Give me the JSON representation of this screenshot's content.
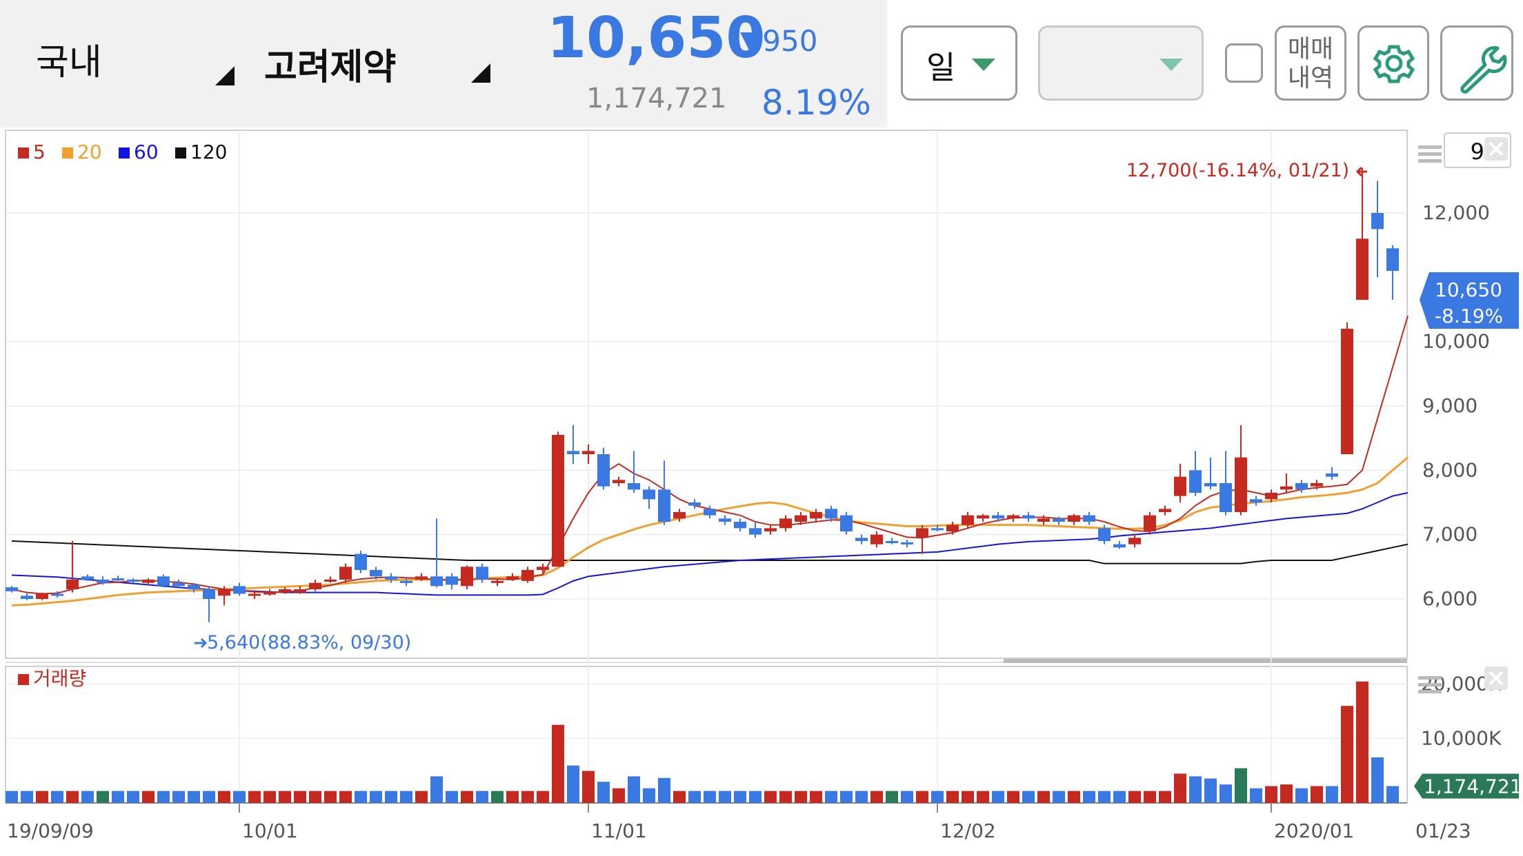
{
  "header": {
    "market": "국내",
    "stock_name": "고려제약",
    "price": "10,650",
    "change": "▼950",
    "volume": "1,174,721",
    "change_rate": "8.19%"
  },
  "toolbar": {
    "period_label": "일",
    "sub_select_value": "",
    "trade_history_label_1": "매매",
    "trade_history_label_2": "내역",
    "settings_icon": "gear-icon",
    "tools_icon": "wrench-icon"
  },
  "colors": {
    "up": "#c42a20",
    "down": "#3a78e2",
    "ma5": "#c42a20",
    "ma20": "#f0a030",
    "ma60": "#1414e0",
    "ma120": "#111111",
    "flat": "#2a7a5a"
  },
  "chart_data": {
    "type": "candlestick",
    "legend": [
      {
        "name": "5",
        "color": "#c42a20"
      },
      {
        "name": "20",
        "color": "#f0a030"
      },
      {
        "name": "60",
        "color": "#1414e0"
      },
      {
        "name": "120",
        "color": "#111111"
      }
    ],
    "period_box_value": "92",
    "y_ticks": [
      6000,
      7000,
      8000,
      9000,
      10000,
      12000
    ],
    "y_tick_labels": [
      "6,000",
      "7,000",
      "8,000",
      "9,000",
      "10,000",
      "12,000"
    ],
    "x_tick_labels": [
      "19/09/09",
      "10/01",
      "11/01",
      "12/02",
      "2020/01",
      "01/23"
    ],
    "x_tick_index": [
      0,
      15,
      38,
      61,
      83,
      92
    ],
    "last_price_label": "10,650",
    "last_change_label": "-8.19%",
    "high_annotation": "12,700(-16.14%, 01/21)",
    "low_annotation": "5,640(88.83%, 09/30)",
    "volume_title": "거래량",
    "volume_ticks": [
      "20,000K",
      "10,000K"
    ],
    "volume_last_label": "1,174,721",
    "candles": [
      [
        6180,
        6120,
        6200,
        6100
      ],
      [
        6050,
        6000,
        6100,
        5980
      ],
      [
        6000,
        6080,
        6100,
        5980
      ],
      [
        6080,
        6050,
        6120,
        6020
      ],
      [
        6150,
        6300,
        6900,
        6100
      ],
      [
        6350,
        6300,
        6380,
        6280
      ],
      [
        6300,
        6250,
        6350,
        6220
      ],
      [
        6320,
        6300,
        6360,
        6280
      ],
      [
        6300,
        6280,
        6320,
        6250
      ],
      [
        6250,
        6300,
        6320,
        6220
      ],
      [
        6350,
        6200,
        6380,
        6180
      ],
      [
        6250,
        6200,
        6300,
        6180
      ],
      [
        6220,
        6150,
        6250,
        6100
      ],
      [
        6150,
        6000,
        6200,
        5640
      ],
      [
        6050,
        6150,
        6200,
        5900
      ],
      [
        6200,
        6080,
        6250,
        6050
      ],
      [
        6050,
        6080,
        6120,
        6000
      ],
      [
        6080,
        6100,
        6150,
        6050
      ],
      [
        6100,
        6150,
        6180,
        6080
      ],
      [
        6100,
        6150,
        6200,
        6080
      ],
      [
        6150,
        6250,
        6300,
        6120
      ],
      [
        6280,
        6300,
        6350,
        6250
      ],
      [
        6300,
        6500,
        6550,
        6250
      ],
      [
        6700,
        6450,
        6750,
        6400
      ],
      [
        6450,
        6350,
        6500,
        6300
      ],
      [
        6350,
        6300,
        6400,
        6250
      ],
      [
        6280,
        6250,
        6320,
        6200
      ],
      [
        6300,
        6350,
        6400,
        6280
      ],
      [
        6350,
        6200,
        7250,
        6180
      ],
      [
        6350,
        6220,
        6400,
        6150
      ],
      [
        6200,
        6500,
        6520,
        6150
      ],
      [
        6500,
        6300,
        6550,
        6250
      ],
      [
        6250,
        6280,
        6300,
        6200
      ],
      [
        6300,
        6350,
        6400,
        6280
      ],
      [
        6280,
        6450,
        6500,
        6250
      ],
      [
        6450,
        6500,
        6550,
        6400
      ],
      [
        6500,
        8550,
        8600,
        6500
      ],
      [
        8300,
        8250,
        8700,
        8100
      ],
      [
        8250,
        8300,
        8400,
        8100
      ],
      [
        8250,
        7750,
        8350,
        7700
      ],
      [
        7800,
        7850,
        7900,
        7750
      ],
      [
        7800,
        7700,
        8300,
        7650
      ],
      [
        7700,
        7550,
        7750,
        7400
      ],
      [
        7700,
        7200,
        8150,
        7150
      ],
      [
        7250,
        7350,
        7400,
        7200
      ],
      [
        7500,
        7450,
        7550,
        7400
      ],
      [
        7400,
        7300,
        7450,
        7250
      ],
      [
        7250,
        7200,
        7300,
        7150
      ],
      [
        7200,
        7100,
        7250,
        7050
      ],
      [
        7100,
        7000,
        7200,
        6950
      ],
      [
        7050,
        7100,
        7150,
        7000
      ],
      [
        7100,
        7250,
        7300,
        7050
      ],
      [
        7200,
        7300,
        7350,
        7150
      ],
      [
        7250,
        7350,
        7400,
        7200
      ],
      [
        7400,
        7250,
        7450,
        7200
      ],
      [
        7300,
        7050,
        7350,
        7000
      ],
      [
        6950,
        6900,
        7000,
        6850
      ],
      [
        6850,
        7000,
        7050,
        6800
      ],
      [
        6900,
        6880,
        6950,
        6850
      ],
      [
        6880,
        6850,
        6920,
        6800
      ],
      [
        6950,
        7100,
        7150,
        6700
      ],
      [
        7100,
        7080,
        7150,
        7050
      ],
      [
        7050,
        7150,
        7200,
        7000
      ],
      [
        7150,
        7300,
        7350,
        7100
      ],
      [
        7250,
        7300,
        7320,
        7200
      ],
      [
        7300,
        7250,
        7350,
        7200
      ],
      [
        7250,
        7300,
        7320,
        7200
      ],
      [
        7300,
        7250,
        7350,
        7200
      ],
      [
        7200,
        7250,
        7300,
        7150
      ],
      [
        7250,
        7200,
        7280,
        7150
      ],
      [
        7200,
        7300,
        7320,
        7150
      ],
      [
        7300,
        7200,
        7350,
        7150
      ],
      [
        7100,
        6900,
        7150,
        6850
      ],
      [
        6850,
        6800,
        6900,
        6780
      ],
      [
        6850,
        6950,
        7000,
        6800
      ],
      [
        7050,
        7300,
        7350,
        7000
      ],
      [
        7350,
        7400,
        7450,
        7300
      ],
      [
        7600,
        7900,
        8100,
        7500
      ],
      [
        8000,
        7650,
        8300,
        7600
      ],
      [
        7800,
        7750,
        8200,
        7700
      ],
      [
        7800,
        7350,
        8300,
        7300
      ],
      [
        7350,
        8200,
        8700,
        7300
      ],
      [
        7550,
        7500,
        7600,
        7450
      ],
      [
        7550,
        7650,
        7700,
        7500
      ],
      [
        7700,
        7750,
        7950,
        7650
      ],
      [
        7800,
        7700,
        7850,
        7650
      ],
      [
        7750,
        7800,
        7850,
        7700
      ],
      [
        7950,
        7900,
        8050,
        7850
      ],
      [
        8250,
        10200,
        10300,
        8250
      ],
      [
        10650,
        11600,
        12700,
        10650
      ],
      [
        12000,
        11750,
        12500,
        11000
      ],
      [
        11450,
        11100,
        11500,
        10650
      ]
    ],
    "ma5": [
      6150,
      6100,
      6080,
      6090,
      6150,
      6200,
      6250,
      6260,
      6280,
      6290,
      6270,
      6260,
      6230,
      6190,
      6150,
      6130,
      6110,
      6100,
      6110,
      6130,
      6170,
      6210,
      6270,
      6310,
      6330,
      6340,
      6330,
      6320,
      6300,
      6290,
      6300,
      6310,
      6310,
      6300,
      6330,
      6380,
      6800,
      7250,
      7650,
      7950,
      8100,
      7950,
      7850,
      7700,
      7550,
      7450,
      7400,
      7350,
      7300,
      7200,
      7150,
      7150,
      7170,
      7200,
      7230,
      7220,
      7170,
      7100,
      7030,
      6960,
      6950,
      6990,
      7030,
      7100,
      7170,
      7220,
      7260,
      7270,
      7270,
      7250,
      7250,
      7250,
      7200,
      7120,
      7060,
      7050,
      7120,
      7250,
      7450,
      7600,
      7680,
      7700,
      7650,
      7600,
      7650,
      7700,
      7730,
      7750,
      7780,
      8000,
      8800,
      9600,
      10400
    ],
    "ma20": [
      5900,
      5910,
      5930,
      5950,
      5970,
      6000,
      6030,
      6060,
      6080,
      6100,
      6110,
      6120,
      6130,
      6140,
      6150,
      6160,
      6170,
      6180,
      6190,
      6200,
      6210,
      6220,
      6240,
      6260,
      6280,
      6290,
      6300,
      6300,
      6300,
      6300,
      6310,
      6320,
      6330,
      6340,
      6350,
      6370,
      6480,
      6650,
      6800,
      6920,
      7000,
      7080,
      7150,
      7200,
      7250,
      7300,
      7350,
      7400,
      7440,
      7480,
      7500,
      7470,
      7400,
      7330,
      7270,
      7220,
      7190,
      7170,
      7150,
      7130,
      7130,
      7140,
      7150,
      7150,
      7150,
      7150,
      7150,
      7150,
      7140,
      7130,
      7120,
      7110,
      7100,
      7090,
      7090,
      7100,
      7150,
      7220,
      7350,
      7420,
      7450,
      7480,
      7500,
      7520,
      7550,
      7580,
      7600,
      7620,
      7650,
      7700,
      7800,
      8000,
      8200
    ],
    "ma60": [
      6370,
      6360,
      6350,
      6340,
      6320,
      6300,
      6280,
      6260,
      6240,
      6220,
      6200,
      6180,
      6160,
      6150,
      6140,
      6130,
      6120,
      6110,
      6100,
      6100,
      6100,
      6100,
      6100,
      6100,
      6100,
      6090,
      6080,
      6070,
      6060,
      6060,
      6060,
      6060,
      6060,
      6060,
      6060,
      6070,
      6170,
      6280,
      6350,
      6380,
      6410,
      6440,
      6470,
      6500,
      6520,
      6540,
      6560,
      6580,
      6600,
      6610,
      6620,
      6630,
      6640,
      6650,
      6660,
      6670,
      6680,
      6690,
      6700,
      6710,
      6720,
      6730,
      6760,
      6790,
      6820,
      6850,
      6870,
      6890,
      6900,
      6910,
      6920,
      6930,
      6950,
      6980,
      7000,
      7020,
      7040,
      7060,
      7080,
      7100,
      7130,
      7160,
      7190,
      7220,
      7250,
      7270,
      7290,
      7310,
      7330,
      7400,
      7500,
      7600,
      7650
    ],
    "ma120": [
      6900,
      6890,
      6880,
      6870,
      6860,
      6850,
      6840,
      6830,
      6820,
      6810,
      6800,
      6790,
      6780,
      6770,
      6760,
      6750,
      6740,
      6730,
      6720,
      6710,
      6700,
      6690,
      6680,
      6670,
      6660,
      6650,
      6640,
      6630,
      6620,
      6610,
      6600,
      6600,
      6600,
      6600,
      6600,
      6600,
      6600,
      6600,
      6600,
      6600,
      6600,
      6600,
      6600,
      6600,
      6600,
      6600,
      6600,
      6600,
      6600,
      6600,
      6600,
      6600,
      6600,
      6600,
      6600,
      6600,
      6600,
      6600,
      6600,
      6600,
      6600,
      6600,
      6600,
      6600,
      6600,
      6600,
      6600,
      6600,
      6600,
      6600,
      6600,
      6600,
      6550,
      6550,
      6550,
      6550,
      6550,
      6550,
      6550,
      6550,
      6550,
      6550,
      6580,
      6600,
      6600,
      6600,
      6600,
      6600,
      6650,
      6700,
      6750,
      6800,
      6850
    ],
    "volume_k": [
      300,
      300,
      300,
      300,
      300,
      300,
      300,
      300,
      300,
      300,
      300,
      300,
      300,
      300,
      300,
      300,
      300,
      300,
      300,
      300,
      300,
      300,
      300,
      300,
      300,
      300,
      300,
      300,
      3000,
      300,
      300,
      300,
      300,
      300,
      300,
      300,
      12500,
      5000,
      4000,
      2000,
      800,
      3000,
      800,
      2700,
      300,
      300,
      300,
      300,
      300,
      300,
      300,
      300,
      300,
      300,
      300,
      300,
      300,
      300,
      300,
      300,
      300,
      300,
      300,
      300,
      300,
      300,
      300,
      300,
      300,
      300,
      300,
      300,
      300,
      300,
      300,
      300,
      300,
      3500,
      3000,
      2600,
      1500,
      4500,
      800,
      1200,
      1500,
      800,
      1200,
      1200,
      16000,
      20500,
      6500,
      1200
    ]
  }
}
